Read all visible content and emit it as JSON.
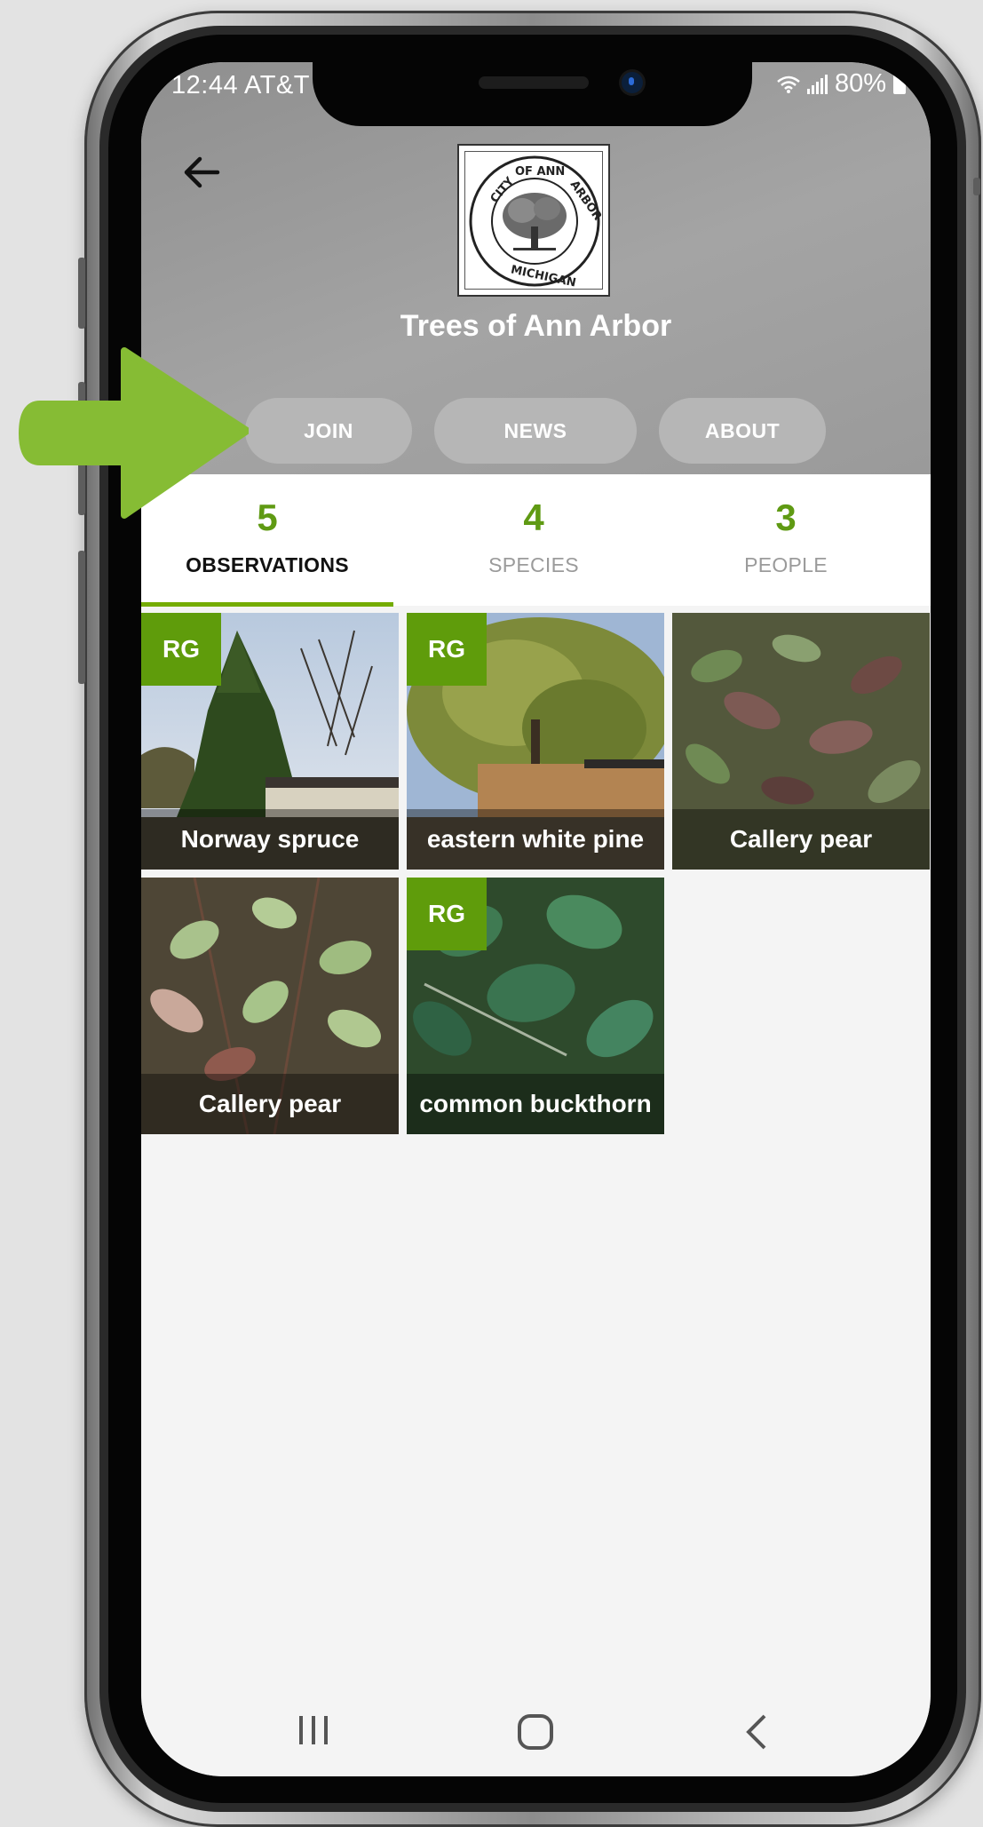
{
  "status_bar": {
    "time": "12:44 AT&T",
    "battery": "80%"
  },
  "project": {
    "title": "Trees of Ann Arbor",
    "logo_top_text": "CITY OF ANN ARBOR",
    "logo_bottom_text": "MICHIGAN"
  },
  "actions": {
    "join": "JOIN",
    "news": "NEWS",
    "about": "ABOUT"
  },
  "tabs": [
    {
      "count": "5",
      "label": "OBSERVATIONS",
      "active": true
    },
    {
      "count": "4",
      "label": "SPECIES",
      "active": false
    },
    {
      "count": "3",
      "label": "PEOPLE",
      "active": false
    }
  ],
  "observations": [
    {
      "name": "Norway spruce",
      "badge": "RG"
    },
    {
      "name": "eastern white pine",
      "badge": "RG"
    },
    {
      "name": "Callery pear",
      "badge": ""
    },
    {
      "name": "Callery pear",
      "badge": ""
    },
    {
      "name": "common buckthorn",
      "badge": "RG"
    }
  ],
  "colors": {
    "accent_green": "#74ac00",
    "arrow_green": "#86bc34",
    "header_gray": "#9a9a9a"
  },
  "icons": {
    "back": "arrow-left-icon",
    "annotation": "right-arrow-icon"
  }
}
